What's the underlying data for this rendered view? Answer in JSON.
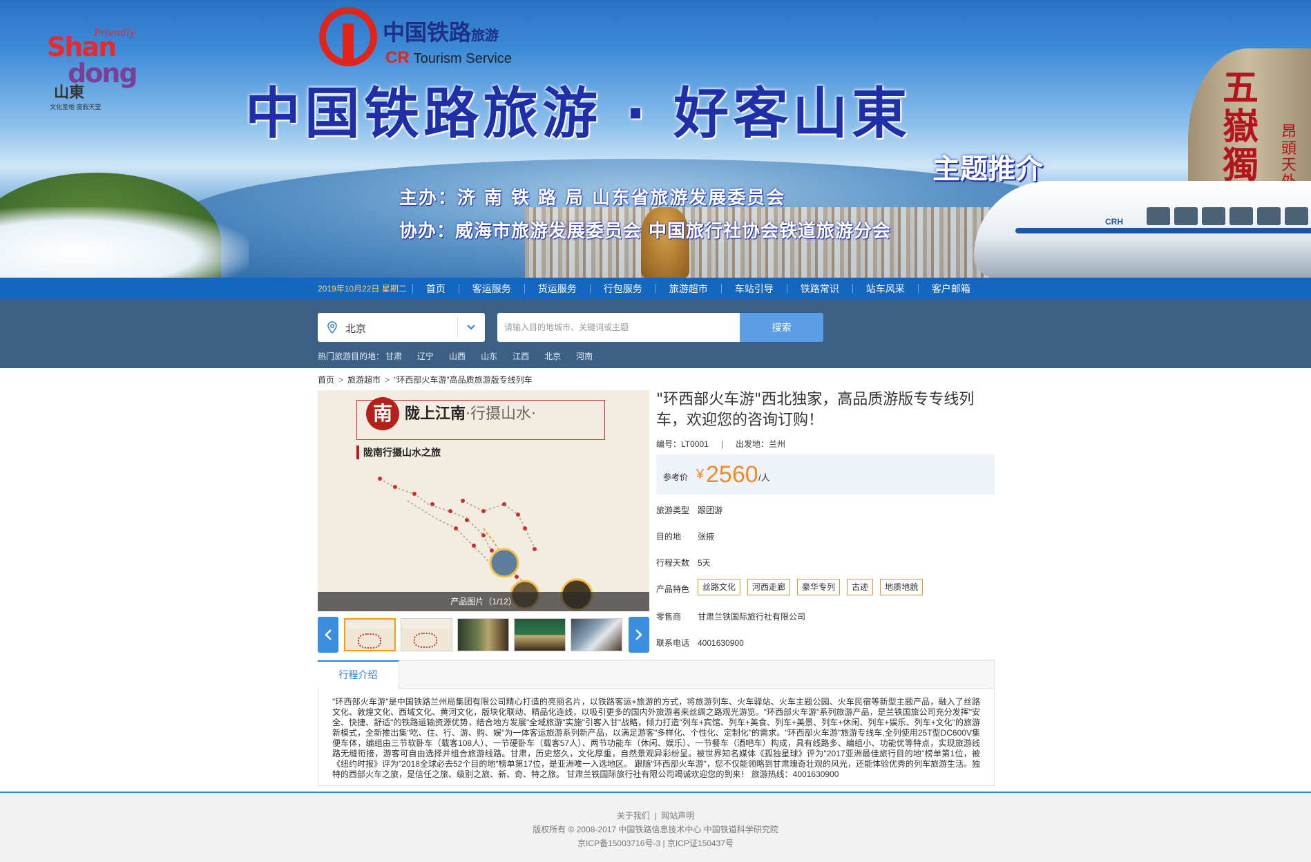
{
  "banner": {
    "logo_sd": {
      "shan": "Shan",
      "dong": "dong",
      "friendly": "Friendly",
      "cn": "山東",
      "motto": "文化圣地 度假天堂"
    },
    "logo_cr": {
      "cn": "中国铁路",
      "cn_small": "旅游",
      "en_prefix": "CR",
      "en": "Tourism Service"
    },
    "title": "中国铁路旅游 · 好客山東",
    "subtitle": "主题推介",
    "host": "主办：济 南 铁 路 局   山东省旅游发展委员会",
    "co_host": "协办：威海市旅游发展委员会   中国旅行社协会铁道旅游分会",
    "rock_text": "五嶽獨尊",
    "rock_text2": "昂頭天外",
    "train_label": "CRH"
  },
  "nav": {
    "date": "2019年10月22日 星期二",
    "items": [
      "首页",
      "客运服务",
      "货运服务",
      "行包服务",
      "旅游超市",
      "车站引导",
      "铁路常识",
      "站车风采",
      "客户邮箱"
    ]
  },
  "search": {
    "city": "北京",
    "placeholder": "请输入目的地城市、关键词或主题",
    "button": "搜索",
    "hot_label": "热门旅游目的地：",
    "hot": [
      "甘肃",
      "辽宁",
      "山西",
      "山东",
      "江西",
      "北京",
      "河南"
    ]
  },
  "breadcrumb": [
    "首页",
    "旅游超市",
    "\"环西部火车游\"高品质旅游版专线列车"
  ],
  "gallery": {
    "badge": "南",
    "title_main": "陇上江南",
    "title_rest": "·行摄山水·",
    "subtitle": "陇南行摄山水之旅",
    "caption": "产品图片（1/12）"
  },
  "product": {
    "title": "\"环西部火车游\"西北独家，高品质游版专专线列车，欢迎您的咨询订购！",
    "code_label": "编号：",
    "code": "LT0001",
    "depart_label": "出发地：",
    "depart": "兰州",
    "price_label": "参考价",
    "currency": "¥",
    "price": "2560",
    "price_unit": "/人",
    "attrs": [
      {
        "k": "旅游类型",
        "v": "跟团游"
      },
      {
        "k": "目的地",
        "v": "张掖"
      },
      {
        "k": "行程天数",
        "v": "5天"
      }
    ],
    "features_label": "产品特色",
    "features": [
      "丝路文化",
      "河西走廊",
      "豪华专列",
      "古迹",
      "地质地貌"
    ],
    "seller_label": "零售商",
    "seller": "甘肃兰铁国际旅行社有限公司",
    "phone_label": "联系电话",
    "phone": "4001630900"
  },
  "itinerary": {
    "tab": "行程介绍",
    "text": "\"环西部火车游\"是中国铁路兰州局集团有限公司精心打造的亮丽名片，以铁路客运+旅游的方式，将旅游列车、火车驿站、火车主题公园、火车民宿等新型主题产品，融入了丝路文化、敦煌文化、西域文化、黄河文化，版块化联动、精品化连线，以吸引更多的国内外旅游者来丝绸之路观光游览。\"环西部火车游\"系列旅游产品，是兰铁国旅公司充分发挥\"安全、快捷、舒适\"的铁路运输资源优势，结合地方发展\"全域旅游\"实施\"引客入甘\"战略，倾力打造\"列车+宾馆、列车+美食、列车+美景、列车+休闲、列车+娱乐、列车+文化\"的旅游新模式，全新推出集\"吃、住、行、游、购、娱\"为一体客运旅游系列新产品，以满足游客\"多样化、个性化、定制化\"的需求。\"环西部火车游\"旅游专线车,全列使用25T型DC600V集便车体，编组由三节软卧车（载客108人）、一节硬卧车（载客57人）、两节功能车（休闲、娱乐）、一节餐车（酒吧车）构成，具有线路多、编组小、功能优等特点，实现旅游线路无缝衔接，游客可自由选择并组合旅游线路。甘肃，历史悠久，文化厚重，自然景观异彩纷呈。被世界知名媒体《孤独星球》评为\"2017亚洲最佳旅行目的地\"榜单第1位，被《纽约时报》评为\"2018全球必去52个目的地\"榜单第17位，是亚洲唯一入选地区。 跟随\"环西部火车游\"，您不仅能领略到甘肃瑰奇壮观的风光，还能体验优秀的列车旅游生活。独特的西部火车之旅，是信任之旅、级别之旅、新、奇、特之旅。 甘肃兰铁国际旅行社有限公司竭诚欢迎您的到来！ 旅游热线：4001630900"
  },
  "footer": {
    "links": [
      "关于我们",
      "网站声明"
    ],
    "copyright": "版权所有 © 2008-2017 中国铁路信息技术中心 中国铁道科学研究院",
    "icp": "京ICP备15003716号-3  |  京ICP证150437号"
  },
  "colors": {
    "nav_blue": "#1467c0",
    "search_band": "#3c5f86",
    "search_button": "#5c9ee6",
    "price_orange": "#f08a24",
    "tag_border": "#f0932b"
  }
}
